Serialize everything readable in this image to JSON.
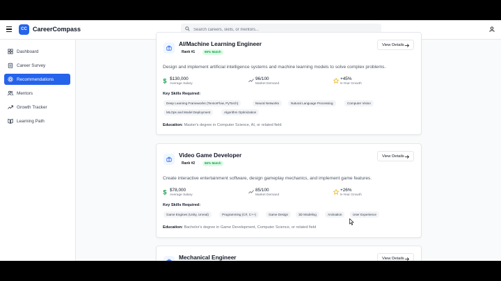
{
  "app": {
    "logo_text": "CC",
    "brand": "CareerCompass"
  },
  "search": {
    "placeholder": "Search careers, skills, or mentors..."
  },
  "sidebar": {
    "items": [
      {
        "label": "Dashboard",
        "icon": "grid-icon",
        "active": false
      },
      {
        "label": "Career Survey",
        "icon": "clipboard-icon",
        "active": false
      },
      {
        "label": "Recommendations",
        "icon": "target-icon",
        "active": true
      },
      {
        "label": "Mentors",
        "icon": "users-icon",
        "active": false
      },
      {
        "label": "Growth Tracker",
        "icon": "trending-up-icon",
        "active": false
      },
      {
        "label": "Learning Path",
        "icon": "book-icon",
        "active": false
      }
    ]
  },
  "cards": [
    {
      "title": "AI/Machine Learning Engineer",
      "rank": "Rank #1",
      "match": "65% Match",
      "view_label": "View Details",
      "description": "Design and implement artificial intelligence systems and machine learning models to solve complex problems.",
      "salary": "$130,000",
      "salary_label": "Average Salary",
      "demand": "96/100",
      "demand_label": "Market Demand",
      "growth": "+45%",
      "growth_label": "5-Year Growth",
      "skills_heading": "Key Skills Required:",
      "skills": [
        "Deep Learning Frameworks (TensorFlow, PyTorch)",
        "Neural Networks",
        "Natural Language Processing",
        "Computer Vision",
        "MLOps and Model Deployment",
        "Algorithm Optimization"
      ],
      "education_label": "Education:",
      "education": "Master's degree in Computer Science, AI, or related field"
    },
    {
      "title": "Video Game Developer",
      "rank": "Rank #2",
      "match": "65% Match",
      "view_label": "View Details",
      "description": "Create interactive entertainment software, design gameplay mechanics, and implement game features.",
      "salary": "$78,000",
      "salary_label": "Average Salary",
      "demand": "85/100",
      "demand_label": "Market Demand",
      "growth": "+26%",
      "growth_label": "5-Year Growth",
      "skills_heading": "Key Skills Required:",
      "skills": [
        "Game Engines (Unity, Unreal)",
        "Programming (C#, C++)",
        "Game Design",
        "3D Modeling",
        "Animation",
        "User Experience"
      ],
      "education_label": "Education:",
      "education": "Bachelor's degree in Game Development, Computer Science, or related field"
    },
    {
      "title": "Mechanical Engineer",
      "view_label": "View Details"
    }
  ],
  "colors": {
    "primary": "#2563eb",
    "match_green": "#16a34a",
    "salary_green": "#16a34a",
    "growth_star": "#eab308"
  }
}
